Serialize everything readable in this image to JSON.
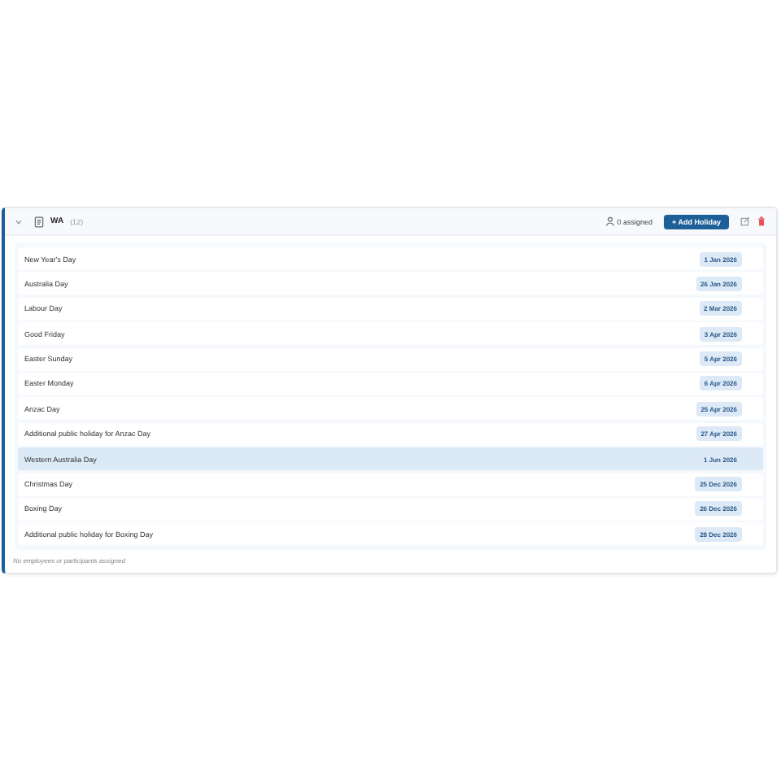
{
  "group": {
    "expanded": true,
    "name": "WA",
    "count": "(12)",
    "assigned": "0 assigned",
    "add_button": "+ Add Holiday"
  },
  "holidays": [
    {
      "name": "New Year's Day",
      "date": "1 Jan 2026",
      "selected": false
    },
    {
      "name": "Australia Day",
      "date": "26 Jan 2026",
      "selected": false
    },
    {
      "name": "Labour Day",
      "date": "2 Mar 2026",
      "selected": false
    },
    {
      "name": "Good Friday",
      "date": "3 Apr 2026",
      "selected": false
    },
    {
      "name": "Easter Sunday",
      "date": "5 Apr 2026",
      "selected": false
    },
    {
      "name": "Easter Monday",
      "date": "6 Apr 2026",
      "selected": false
    },
    {
      "name": "Anzac Day",
      "date": "25 Apr 2026",
      "selected": false
    },
    {
      "name": "Additional public holiday for Anzac Day",
      "date": "27 Apr 2026",
      "selected": false
    },
    {
      "name": "Western Australia Day",
      "date": "1 Jun 2026",
      "selected": true
    },
    {
      "name": "Christmas Day",
      "date": "25 Dec 2026",
      "selected": false
    },
    {
      "name": "Boxing Day",
      "date": "26 Dec 2026",
      "selected": false
    },
    {
      "name": "Additional public holiday for Boxing Day",
      "date": "28 Dec 2026",
      "selected": false
    }
  ],
  "footer": "No employees or participants assigned"
}
